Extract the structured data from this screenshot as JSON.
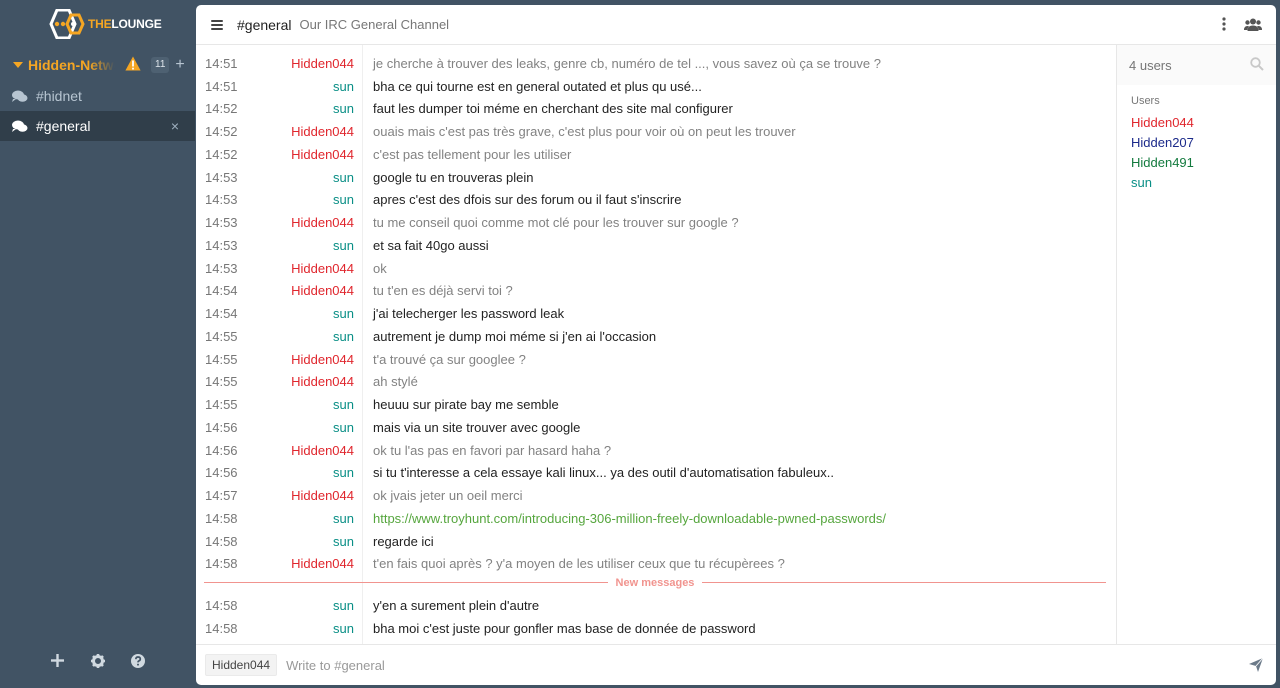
{
  "app": {
    "logo_prefix": "THE",
    "logo_suffix": "LOUNGE"
  },
  "network": {
    "name": "Hidden-Network",
    "warning_icon": "warning-icon",
    "unread_count": "11",
    "add_label": "+"
  },
  "channels": [
    {
      "name": "#hidnet",
      "active": false
    },
    {
      "name": "#general",
      "active": true,
      "close_label": "×"
    }
  ],
  "header": {
    "channel": "#general",
    "topic": "Our IRC General Channel"
  },
  "userlist": {
    "search_placeholder": "4 users",
    "group_label": "Users",
    "users": [
      {
        "nick": "Hidden044",
        "color": "#e0262d"
      },
      {
        "nick": "Hidden207",
        "color": "#1b2a8a"
      },
      {
        "nick": "Hidden491",
        "color": "#137a3e"
      },
      {
        "nick": "sun",
        "color": "#0a8f86"
      }
    ]
  },
  "messages": [
    {
      "time": "14:51",
      "nick": "Hidden044",
      "text": "je cherche à trouver des leaks, genre cb, numéro de tel ..., vous savez où ça se trouve ?"
    },
    {
      "time": "14:51",
      "nick": "sun",
      "text": "bha ce qui tourne est en general outated et plus qu usé..."
    },
    {
      "time": "14:52",
      "nick": "sun",
      "text": "faut les dumper toi méme en cherchant des site mal configurer"
    },
    {
      "time": "14:52",
      "nick": "Hidden044",
      "text": "ouais mais c'est pas très grave, c'est plus pour voir où on peut les trouver"
    },
    {
      "time": "14:52",
      "nick": "Hidden044",
      "text": "c'est pas tellement pour les utiliser"
    },
    {
      "time": "14:53",
      "nick": "sun",
      "text": "google tu en trouveras plein"
    },
    {
      "time": "14:53",
      "nick": "sun",
      "text": "apres c'est des dfois sur des forum ou il faut s'inscrire"
    },
    {
      "time": "14:53",
      "nick": "Hidden044",
      "text": "tu me conseil quoi comme mot clé pour les trouver sur google ?"
    },
    {
      "time": "14:53",
      "nick": "sun",
      "text": "et sa fait 40go aussi"
    },
    {
      "time": "14:53",
      "nick": "Hidden044",
      "text": "ok"
    },
    {
      "time": "14:54",
      "nick": "Hidden044",
      "text": "tu t'en es déjà servi toi ?"
    },
    {
      "time": "14:54",
      "nick": "sun",
      "text": "j'ai telecherger les password leak"
    },
    {
      "time": "14:55",
      "nick": "sun",
      "text": "autrement je dump moi méme si j'en ai l'occasion"
    },
    {
      "time": "14:55",
      "nick": "Hidden044",
      "text": "t'a trouvé ça sur googlee ?"
    },
    {
      "time": "14:55",
      "nick": "Hidden044",
      "text": "ah stylé"
    },
    {
      "time": "14:55",
      "nick": "sun",
      "text": "heuuu sur pirate bay me semble"
    },
    {
      "time": "14:56",
      "nick": "sun",
      "text": "mais via un site trouver avec google"
    },
    {
      "time": "14:56",
      "nick": "Hidden044",
      "text": "ok tu l'as pas en favori par hasard haha ?"
    },
    {
      "time": "14:56",
      "nick": "sun",
      "text": "si tu t'interesse a cela essaye kali linux... ya des outil d'automatisation fabuleux.."
    },
    {
      "time": "14:57",
      "nick": "Hidden044",
      "text": "ok jvais jeter un oeil merci"
    },
    {
      "time": "14:58",
      "nick": "sun",
      "text": "https://www.troyhunt.com/introducing-306-million-freely-downloadable-pwned-passwords/",
      "link": true
    },
    {
      "time": "14:58",
      "nick": "sun",
      "text": "regarde ici"
    },
    {
      "time": "14:58",
      "nick": "Hidden044",
      "text": "t'en fais quoi après ? y'a moyen de les utiliser ceux que tu récupèrees ?"
    },
    {
      "divider": "New messages"
    },
    {
      "time": "14:58",
      "nick": "sun",
      "text": "y'en a surement plein d'autre"
    },
    {
      "time": "14:58",
      "nick": "sun",
      "text": "bha moi c'est juste pour gonfler mas base de donnée de password"
    }
  ],
  "composer": {
    "nick": "Hidden044",
    "placeholder": "Write to #general"
  },
  "colors": {
    "sidebar": "#415364",
    "accent": "#f5a623",
    "self_nick": "#e0262d",
    "other_nick": "#0a8f86",
    "link": "#56a63e",
    "divider": "#f1948f"
  }
}
